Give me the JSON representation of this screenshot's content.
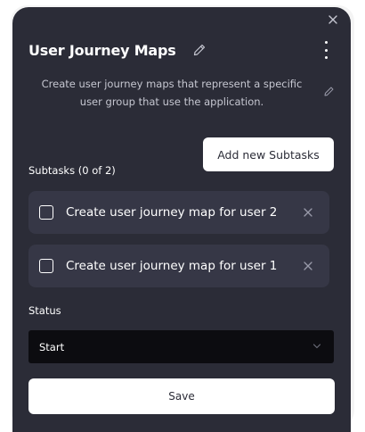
{
  "task": {
    "title": "User Journey Maps",
    "description": "Create user journey maps that represent a specific user group that use the application."
  },
  "subtasks": {
    "label": "Subtasks (0 of 2)",
    "add_button": "Add new Subtasks",
    "items": [
      {
        "text": "Create user journey map for user 2",
        "checked": false
      },
      {
        "text": "Create user journey map for user 1",
        "checked": false
      }
    ]
  },
  "status": {
    "label": "Status",
    "selected": "Start"
  },
  "save_button": "Save",
  "icons": {
    "close": "close-icon",
    "edit": "pencil-icon",
    "more": "kebab-menu-icon",
    "remove": "remove-icon",
    "dropdown": "chevron-down-icon"
  },
  "colors": {
    "card_background": "#2b2c37",
    "subtask_background": "#363746",
    "select_background": "#0c0c10",
    "button_background": "#ffffff"
  }
}
